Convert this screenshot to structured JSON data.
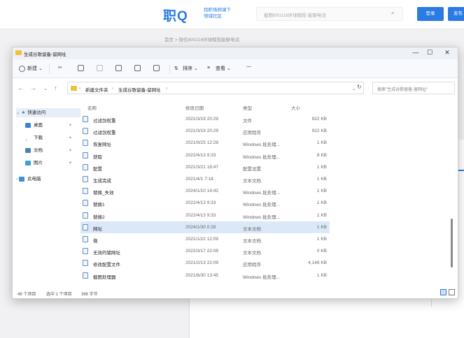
{
  "site": {
    "logo_text": "职Q",
    "slogan": "找职场网课下\n领域社区",
    "search_placeholder": "截图800216环球鲸投·能聊电话",
    "login_label": "登录",
    "post_label": "发布",
    "breadcrumb": "首页 > 微信800216环球鲸投能聊电话"
  },
  "window": {
    "title": "生成谷歌留备-留网址",
    "controls": {
      "minimize": "—",
      "maximize": "☐",
      "close": "✕"
    }
  },
  "commands": {
    "new_label": "新建",
    "sort_label": "排序",
    "view_label": "查看",
    "more_label": "···"
  },
  "address": {
    "crumbs": [
      "新建文件夹",
      "生成谷歌留备-留网址"
    ],
    "search_placeholder": "搜索\"生成谷歌留备-留网址\""
  },
  "sidebar": {
    "items": [
      {
        "label": "快速访问",
        "icon": "star-icon",
        "color": "#2a7be4"
      },
      {
        "label": "桌面",
        "icon": "desktop-icon",
        "color": "#3b82d6"
      },
      {
        "label": "下载",
        "icon": "download-icon",
        "color": "#2a7be4"
      },
      {
        "label": "文档",
        "icon": "document-icon",
        "color": "#4c7fb8"
      },
      {
        "label": "图片",
        "icon": "picture-icon",
        "color": "#3fa0d8"
      },
      {
        "label": "此电脑",
        "icon": "computer-icon",
        "color": "#3f8fd8"
      }
    ]
  },
  "columns": {
    "name": "名称",
    "date": "修改日期",
    "type": "类型",
    "size": "大小"
  },
  "files": [
    {
      "name": "过滤剑权重",
      "date": "2021/3/19 20:29",
      "type": "文件",
      "size": "922 KB"
    },
    {
      "name": "过滤剑权重",
      "date": "2021/3/19 20:29",
      "type": "应用程序",
      "size": "922 KB"
    },
    {
      "name": "恢复网址",
      "date": "2021/9/25 12:28",
      "type": "Windows 批处理...",
      "size": "1 KB"
    },
    {
      "name": "获取",
      "date": "2022/4/13 9:33",
      "type": "Windows 批处理...",
      "size": "8 KB"
    },
    {
      "name": "配置",
      "date": "2021/3/21 18:47",
      "type": "配置设置",
      "size": "1 KB"
    },
    {
      "name": "生成完成",
      "date": "2021/4/1 7:18",
      "type": "文本文档",
      "size": "1 KB"
    },
    {
      "name": "替换_失效",
      "date": "2024/1/10 14:42",
      "type": "Windows 批处理...",
      "size": "1 KB"
    },
    {
      "name": "替换1",
      "date": "2022/4/13 9:33",
      "type": "Windows 批处理...",
      "size": "1 KB"
    },
    {
      "name": "替换2",
      "date": "2022/4/13 9:33",
      "type": "Windows 批处理...",
      "size": "1 KB"
    },
    {
      "name": "网址",
      "date": "2024/1/30 0:28",
      "type": "文本文档",
      "size": "1 KB"
    },
    {
      "name": "微",
      "date": "2021/1/22 12:09",
      "type": "文本文档",
      "size": "1 KB"
    },
    {
      "name": "无效的猪网址",
      "date": "2022/3/17 22:08",
      "type": "文本文档",
      "size": "0 KB"
    },
    {
      "name": "修改配置文件",
      "date": "2021/2/13 22:09",
      "type": "应用程序",
      "size": "4,149 KB"
    },
    {
      "name": "截图处理器",
      "date": "2021/6/30 13:45",
      "type": "Windows 批处理...",
      "size": "1 KB"
    }
  ],
  "selected_index": 9,
  "status": {
    "count": "46 个项目",
    "selected": "选中 1 个项目",
    "size": "366 字节"
  }
}
